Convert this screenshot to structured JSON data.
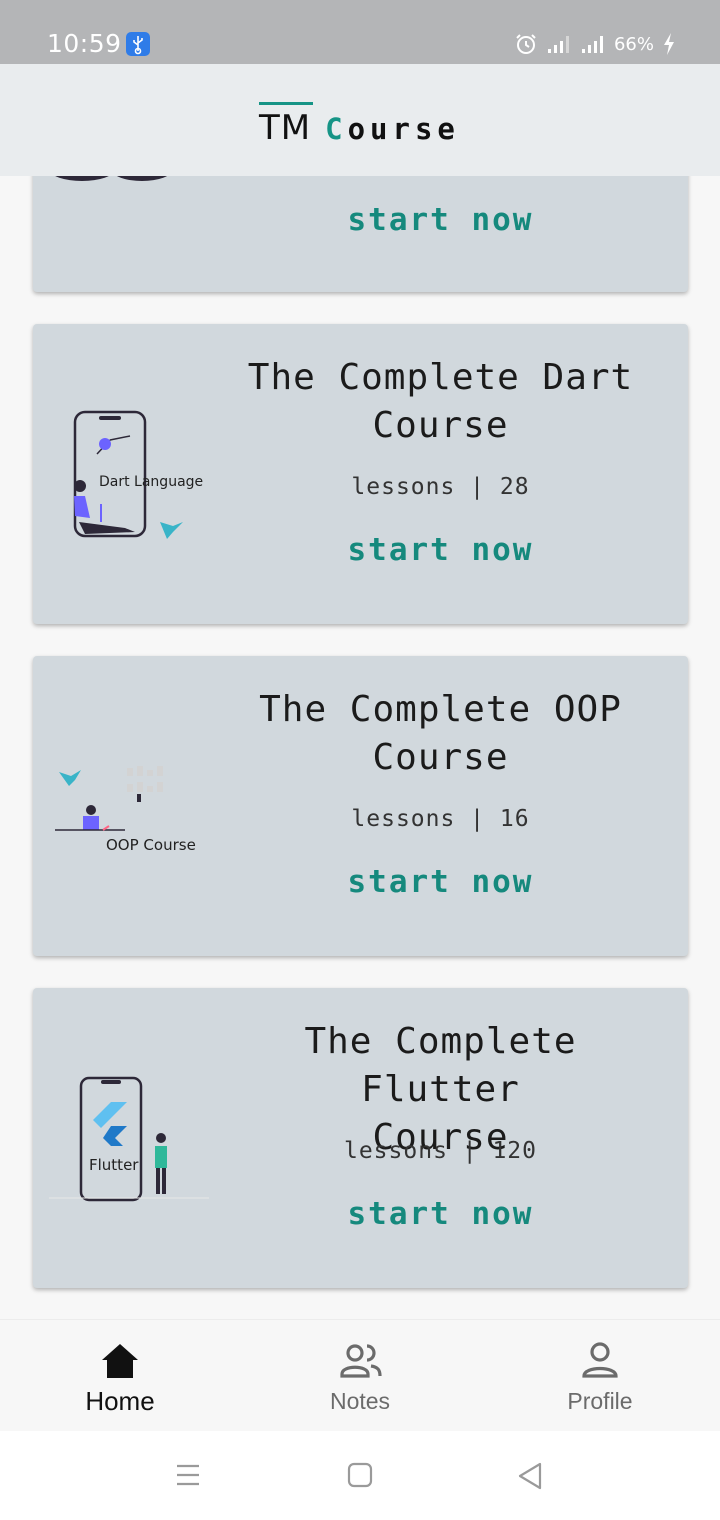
{
  "status_bar": {
    "time": "10:59",
    "battery": "66%",
    "icons": [
      "usb-icon",
      "alarm-icon",
      "signal-icon",
      "battery-charging-icon"
    ]
  },
  "app_bar": {
    "logo_tm": "TM",
    "logo_first_letter": "C",
    "logo_rest": "ourse",
    "accent_color": "#169486"
  },
  "courses": [
    {
      "title_line1": "",
      "title_line2": "",
      "lessons": "",
      "start": "start now",
      "image_label": ""
    },
    {
      "title_line1": "The Complete Dart",
      "title_line2": "Course",
      "lessons": "lessons | 28",
      "start": "start now",
      "image_label": "Dart Language"
    },
    {
      "title_line1": "The Complete OOP",
      "title_line2": "Course",
      "lessons": "lessons | 16",
      "start": "start now",
      "image_label": "OOP Course"
    },
    {
      "title_line1": "The Complete Flutter",
      "title_line2": "Course",
      "lessons": "lessons | 120",
      "start": "start now",
      "image_label": "Flutter"
    }
  ],
  "bottom_nav": {
    "items": [
      {
        "label": "Home",
        "icon": "home-icon",
        "active": true
      },
      {
        "label": "Notes",
        "icon": "people-icon",
        "active": false
      },
      {
        "label": "Profile",
        "icon": "person-icon",
        "active": false
      }
    ]
  },
  "system_nav": {
    "icons": [
      "recents-icon",
      "home-square-icon",
      "back-triangle-icon"
    ]
  }
}
